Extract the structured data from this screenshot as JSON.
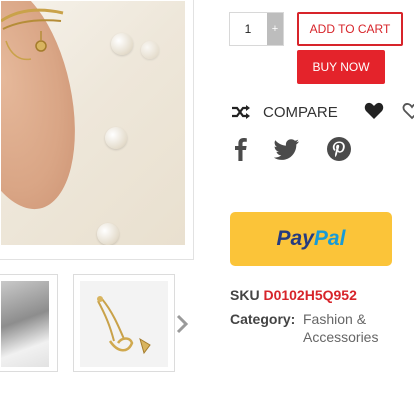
{
  "product": {
    "main_image": {
      "desc_icon": "product-photo"
    },
    "thumbnails": [
      {
        "icon": "thumbnail-photo"
      },
      {
        "icon": "thumbnail-bracelet"
      }
    ]
  },
  "purchase": {
    "quantity": "1",
    "plus_symbol": "+",
    "add_to_cart_label": "ADD TO CART",
    "buy_now_label": "BUY NOW"
  },
  "actions": {
    "compare_label": "COMPARE"
  },
  "paypal": {
    "pay": "Pay",
    "pal": "Pal"
  },
  "meta": {
    "sku_label": "SKU",
    "sku_value": "D0102H5Q952",
    "category_label": "Category:",
    "category_value": "Fashion & Accessories"
  },
  "colors": {
    "accent_red": "#e4232b",
    "paypal_yellow": "#fbc439",
    "paypal_dark_blue": "#253b80",
    "paypal_light_blue": "#179bd7"
  }
}
